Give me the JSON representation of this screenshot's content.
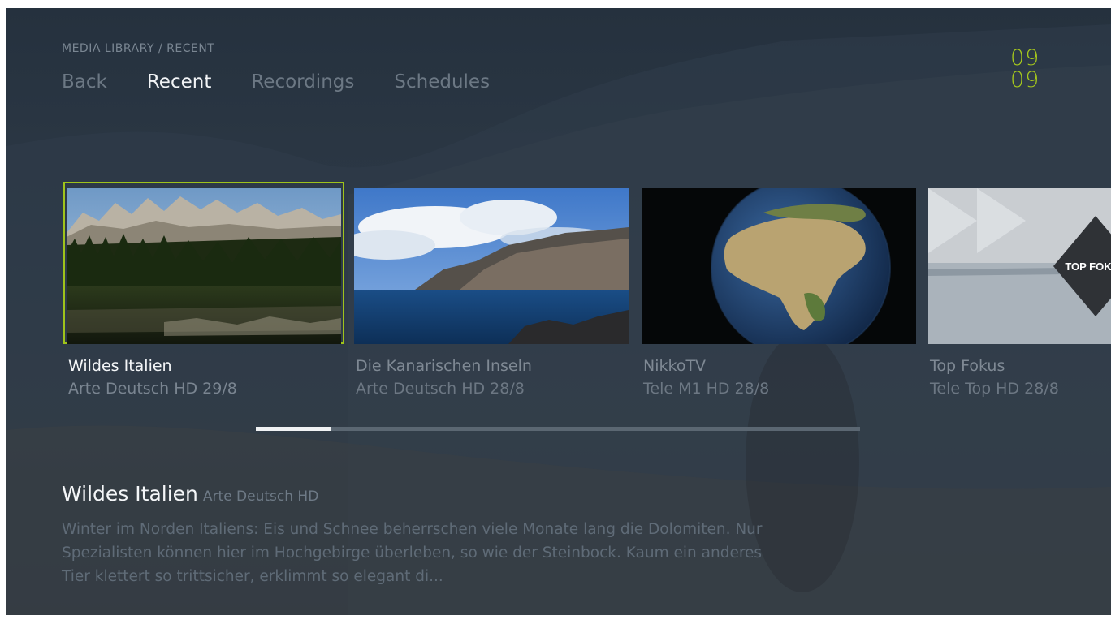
{
  "breadcrumb": "MEDIA LIBRARY / RECENT",
  "nav": [
    {
      "label": "Back"
    },
    {
      "label": "Recent"
    },
    {
      "label": "Recordings"
    },
    {
      "label": "Schedules"
    }
  ],
  "active_tab": "Recent",
  "clock": {
    "hours": "09",
    "minutes": "09"
  },
  "accent_color": "#a6c81c",
  "cards": [
    {
      "title": "Wildes Italien",
      "channel": "Arte Deutsch HD",
      "date": "29/8",
      "subtitle": "Arte Deutsch HD 29/8",
      "image": "mountain-lake"
    },
    {
      "title": "Die Kanarischen Inseln",
      "channel": "Arte Deutsch HD",
      "date": "28/8",
      "subtitle": "Arte Deutsch HD 28/8",
      "image": "coastal-cliffs"
    },
    {
      "title": "NikkoTV",
      "channel": "Tele M1 HD",
      "date": "28/8",
      "subtitle": "Tele M1 HD 28/8",
      "image": "earth-globe"
    },
    {
      "title": "Top Fokus",
      "channel": "Tele Top HD",
      "date": "28/8",
      "subtitle": "Tele Top HD 28/8",
      "image": "top-fokus-logo",
      "logo_text": "TOP FOKUS"
    }
  ],
  "selected_index": 0,
  "scroll_progress": 0.125,
  "detail": {
    "title": "Wildes Italien",
    "channel": "Arte Deutsch HD",
    "description": "Winter im Norden Italiens: Eis und Schnee beherrschen viele Monate lang die Dolomiten. Nur Spezialisten können hier im Hochgebirge überleben, so wie der Steinbock. Kaum ein anderes Tier klettert so trittsicher, erklimmt so elegant di..."
  }
}
